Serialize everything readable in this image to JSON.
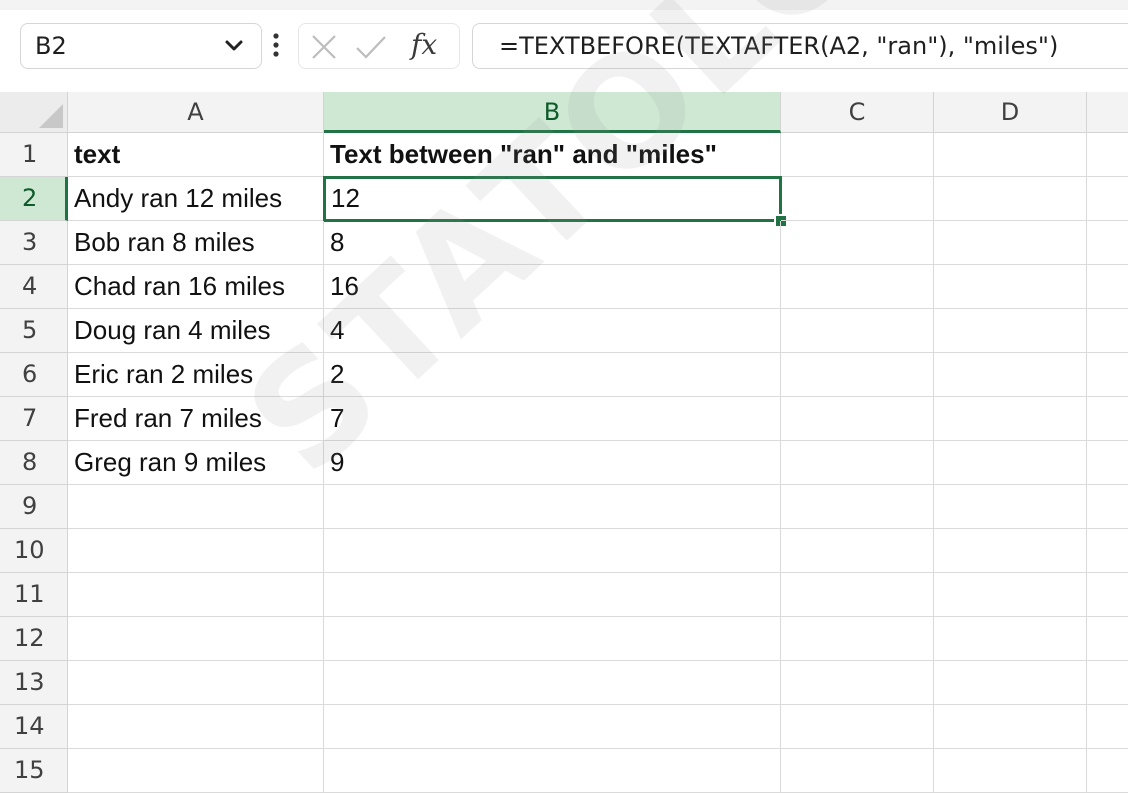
{
  "formula_bar": {
    "name_box": "B2",
    "formula": "=TEXTBEFORE(TEXTAFTER(A2, \"ran\"), \"miles\")",
    "fx_label": "fx"
  },
  "columns": [
    "A",
    "B",
    "C",
    "D"
  ],
  "rows": [
    "1",
    "2",
    "3",
    "4",
    "5",
    "6",
    "7",
    "8",
    "9",
    "10",
    "11",
    "12",
    "13",
    "14",
    "15"
  ],
  "selection": {
    "column": "B",
    "row": "2",
    "cell": "B2"
  },
  "cells": {
    "A": [
      "text",
      "Andy ran 12 miles",
      "Bob ran 8 miles",
      "Chad ran 16 miles",
      "Doug ran 4 miles",
      "Eric ran 2 miles",
      "Fred ran 7 miles",
      "Greg ran 9 miles"
    ],
    "B": [
      "Text between \"ran\" and \"miles\"",
      "12",
      "8",
      "16",
      "4",
      "2",
      "7",
      "9"
    ]
  },
  "watermark": "STATOLOGY.COM",
  "colors": {
    "accent": "#217346",
    "selected_header": "#cfe8d4"
  }
}
